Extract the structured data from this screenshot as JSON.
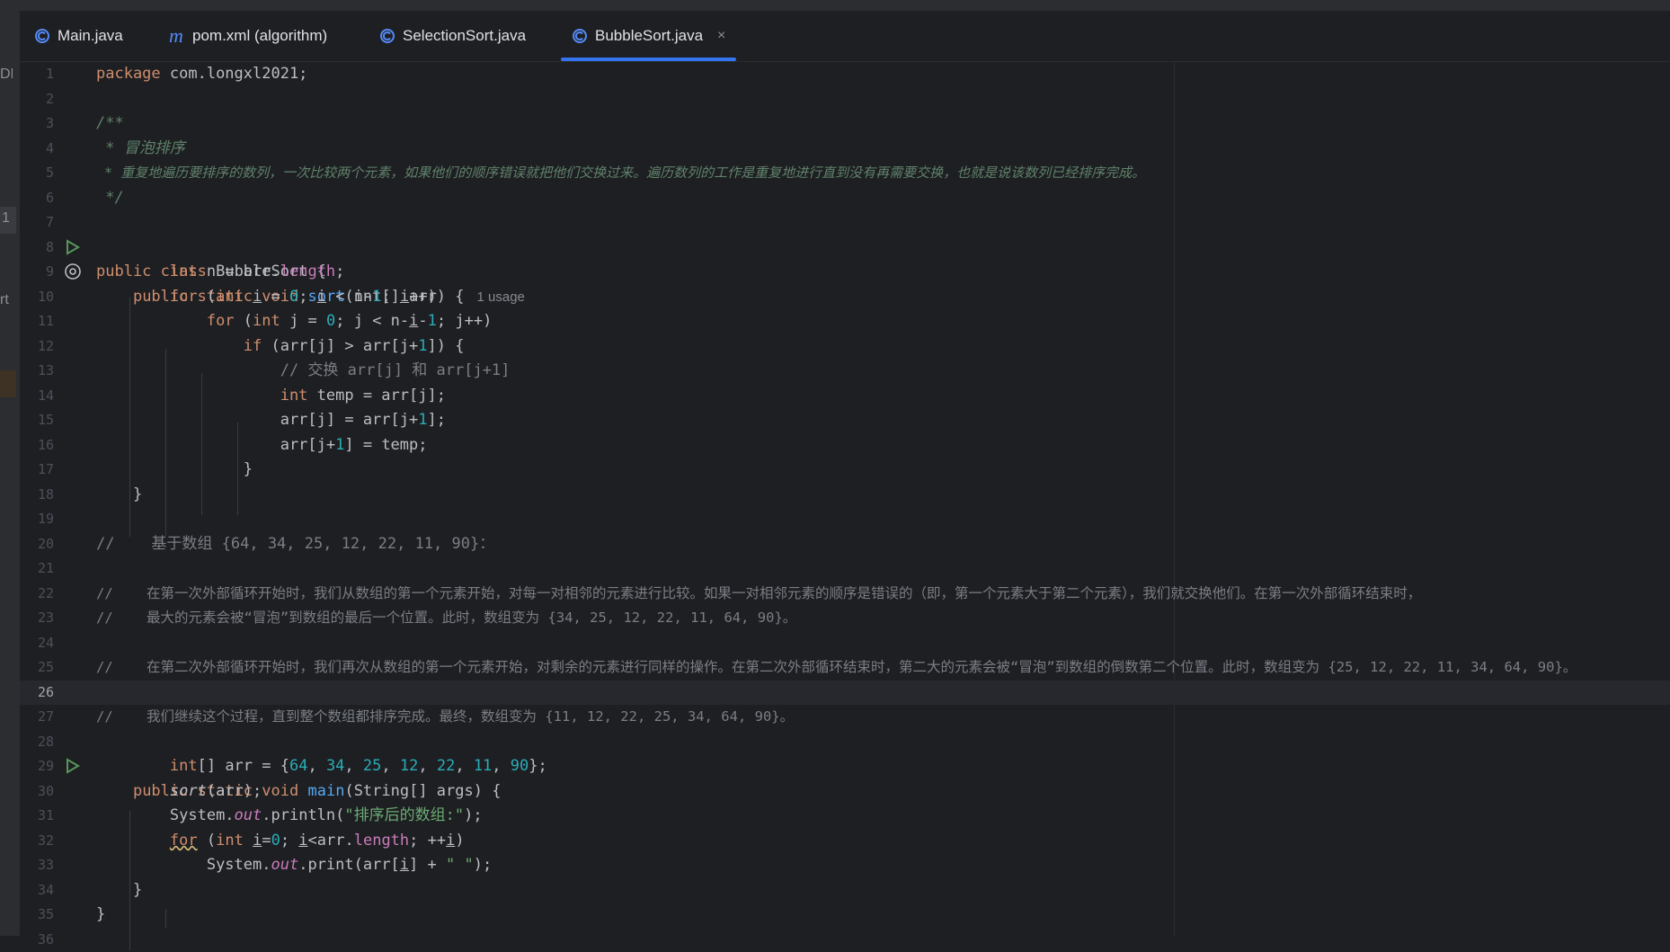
{
  "left_panel": {
    "marker_top": "DEV",
    "marker_1": "1",
    "marker_ort": "rt"
  },
  "tabs": [
    {
      "label": "Main.java",
      "icon": "java-class-icon",
      "active": false
    },
    {
      "label": "pom.xml (algorithm)",
      "icon": "maven-icon",
      "active": false
    },
    {
      "label": "SelectionSort.java",
      "icon": "java-class-icon",
      "active": false
    },
    {
      "label": "BubbleSort.java",
      "icon": "java-class-icon",
      "active": true,
      "close": "×"
    }
  ],
  "editor": {
    "current_line": 26,
    "usage_hint": "1 usage",
    "line_numbers": [
      "1",
      "2",
      "3",
      "4",
      "5",
      "6",
      "7",
      "8",
      "9",
      "10",
      "11",
      "12",
      "13",
      "14",
      "15",
      "16",
      "17",
      "18",
      "19",
      "20",
      "21",
      "22",
      "23",
      "24",
      "25",
      "26",
      "27",
      "28",
      "29",
      "30",
      "31",
      "32",
      "33",
      "34",
      "35",
      "36"
    ],
    "text": {
      "pkg_kw": "package",
      "pkg_name": " com.longxl2021;",
      "doc_open": "/**",
      "doc_title": " * 冒泡排序",
      "doc_desc": " * 重复地遍历要排序的数列，一次比较两个元素，如果他们的顺序错误就把他们交换过来。遍历数列的工作是重复地进行直到没有再需要交换，也就是说该数列已经排序完成。",
      "doc_close": " */",
      "public": "public",
      "class": "class",
      "static": "static",
      "void": "void",
      "int": "int",
      "for": "for",
      "if": "if",
      "class_name": " BubbleSort {",
      "sort": "sort",
      "main": "main",
      "main_params": "(String[] args) {",
      "sort_params": "(int[] arr) {",
      "n_decl": " n = arr.",
      "length": "length",
      "semi": ";",
      "i": "i",
      "j": "j",
      "zero": "0",
      "one": "1",
      "for1_open": " (",
      "eq": " = ",
      "lt_n_minus": "; ",
      "lt_n": " < n-",
      "incr_i": "++)",
      "lt_n_minus_i": " < n-",
      "minus": "-",
      "incr_j": "; j++)",
      "if_cond_a": " (arr[j] > arr[j+",
      "if_cond_b": "]) {",
      "swap_comment": "// 交换 arr[j] 和 arr[j+1]",
      "temp_decl": " temp = arr[j];",
      "assign_a": "arr[j] = arr[j+",
      "assign_b": "];",
      "assign_c": "arr[j+",
      "assign_d": "] = temp;",
      "brace_close": "}",
      "c20": "//    基于数组 {64, 34, 25, 12, 22, 11, 90}：",
      "c22": "//    在第一次外部循环开始时，我们从数组的第一个元素开始，对每一对相邻的元素进行比较。如果一对相邻元素的顺序是错误的（即，第一个元素大于第二个元素），我们就交换他们。在第一次外部循环结束时，",
      "c23": "//    最大的元素会被“冒泡”到数组的最后一个位置。此时，数组变为 {34, 25, 12, 22, 11, 64, 90}。",
      "c25": "//    在第二次外部循环开始时，我们再次从数组的第一个元素开始，对剩余的元素进行同样的操作。在第二次外部循环结束时，第二大的元素会被“冒泡”到数组的倒数第二个位置。此时，数组变为 {25, 12, 22, 11, 34, 64, 90}。",
      "c27": "//    我们继续这个过程，直到整个数组都排序完成。最终，数组变为 {11, 12, 22, 25, 34, 64, 90}。",
      "arr_decl": "[] arr = {",
      "n64": "64",
      "n34": "34",
      "n25": "25",
      "n12": "12",
      "n22": "22",
      "n11": "11",
      "n90": "90",
      "comma": ", ",
      "arr_end": "};",
      "sort_call": "sort",
      "sort_call_args": "(arr);",
      "system": "System.",
      "out": "out",
      "println": ".println(",
      "print_str": "\"排序后的数组:\"",
      "call_end": ");",
      "for2_open": " (",
      "i_init": "i",
      "eq0": "=",
      "lt_arr": "; ",
      "lt_arr2": "<arr.",
      "pre_incr": "; ++",
      "close_paren": ")",
      "print": ".print(arr[",
      "plus_space": "] + ",
      "space_str": "\" \"",
      "stub": "..."
    }
  },
  "colors": {
    "background": "#1e1f22",
    "keyword": "#cf8e6d",
    "number": "#2aacb8",
    "string": "#6aab73",
    "doc_comment": "#5f826b",
    "line_comment": "#7a7e85",
    "method": "#56a8f5",
    "field": "#c77dbb",
    "accent": "#3574f0"
  }
}
